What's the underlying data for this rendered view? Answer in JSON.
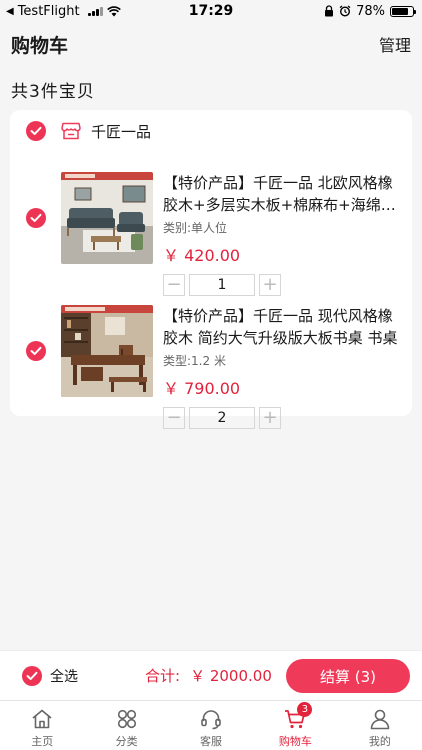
{
  "status_bar": {
    "back_app": "TestFlight",
    "time": "17:29",
    "battery": "78%",
    "battery_level": 0.78
  },
  "header": {
    "title": "购物车",
    "manage": "管理"
  },
  "cart_count": "共3件宝贝",
  "shop": {
    "name": "千匠一品"
  },
  "items": [
    {
      "name": "【特价产品】千匠一品 北欧风格橡胶木+多层实木板+棉麻布+海绵 沙发",
      "spec": "类别:单人位",
      "price": "￥ 420.00",
      "qty": "1"
    },
    {
      "name": "【特价产品】千匠一品 现代风格橡胶木 简约大气升级版大板书桌 书桌",
      "spec": "类型:1.2 米",
      "price": "￥ 790.00",
      "qty": "2"
    }
  ],
  "stepper": {
    "minus": "−",
    "plus": "+"
  },
  "checkout_bar": {
    "select_all": "全选",
    "total_label": "合计:",
    "total_amount": "￥ 2000.00",
    "checkout_button": "结算 (3)"
  },
  "tabs": [
    {
      "label": "主页",
      "icon": "home-icon"
    },
    {
      "label": "分类",
      "icon": "category-icon"
    },
    {
      "label": "客服",
      "icon": "headset-icon"
    },
    {
      "label": "购物车",
      "icon": "cart-icon",
      "badge": "3",
      "active": true
    },
    {
      "label": "我的",
      "icon": "user-icon"
    }
  ],
  "colors": {
    "accent": "#e2233c",
    "checkbox": "#ee3455",
    "button": "#ef3a5a",
    "background": "#f5f5f5"
  }
}
